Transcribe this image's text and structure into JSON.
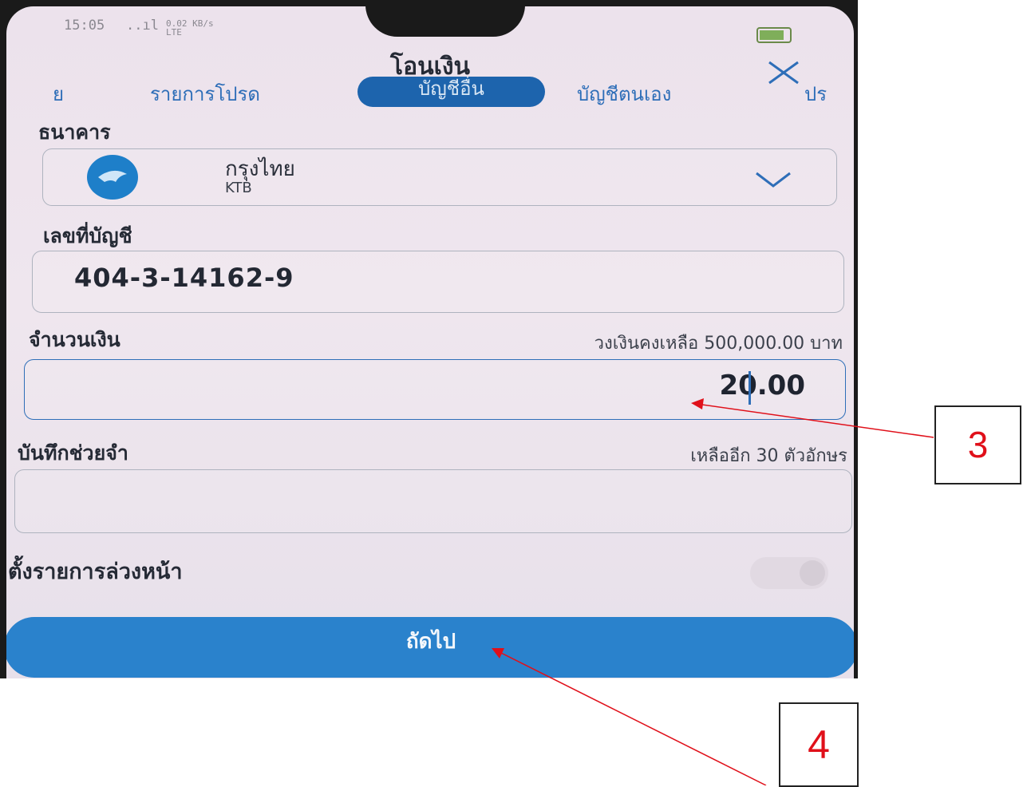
{
  "status_bar": {
    "time": "15:05",
    "signal": "..ıl",
    "network": "0.02 KB/s LTE"
  },
  "header": {
    "title": "โอนเงิน",
    "close_icon": "close-icon"
  },
  "tabs": [
    {
      "label": "ย",
      "active": false
    },
    {
      "label": "รายการโปรด",
      "active": false
    },
    {
      "label": "บัญชีอื่น",
      "active": true
    },
    {
      "label": "บัญชีตนเอง",
      "active": false
    },
    {
      "label": "ปร",
      "active": false
    }
  ],
  "bank": {
    "label": "ธนาคาร",
    "name": "กรุงไทย",
    "code": "KTB",
    "icon": "bank-logo-icon"
  },
  "account": {
    "label": "เลขที่บัญชี",
    "value": "404-3-14162-9"
  },
  "amount": {
    "label": "จำนวนเงิน",
    "limit_text": "วงเงินคงเหลือ 500,000.00 บาท",
    "value": "20.00"
  },
  "memo": {
    "label": "บันทึกช่วยจำ",
    "remaining_text": "เหลืออีก 30 ตัวอักษร",
    "value": ""
  },
  "schedule": {
    "label": "ตั้งรายการล่วงหน้า",
    "enabled": false
  },
  "next_button": {
    "label": "ถัดไป"
  },
  "annotations": [
    {
      "label": "3",
      "color": "#e0101a"
    },
    {
      "label": "4",
      "color": "#e0101a"
    }
  ],
  "colors": {
    "accent": "#1d64ad",
    "button": "#2a82cc",
    "annotation": "#e0101a"
  }
}
